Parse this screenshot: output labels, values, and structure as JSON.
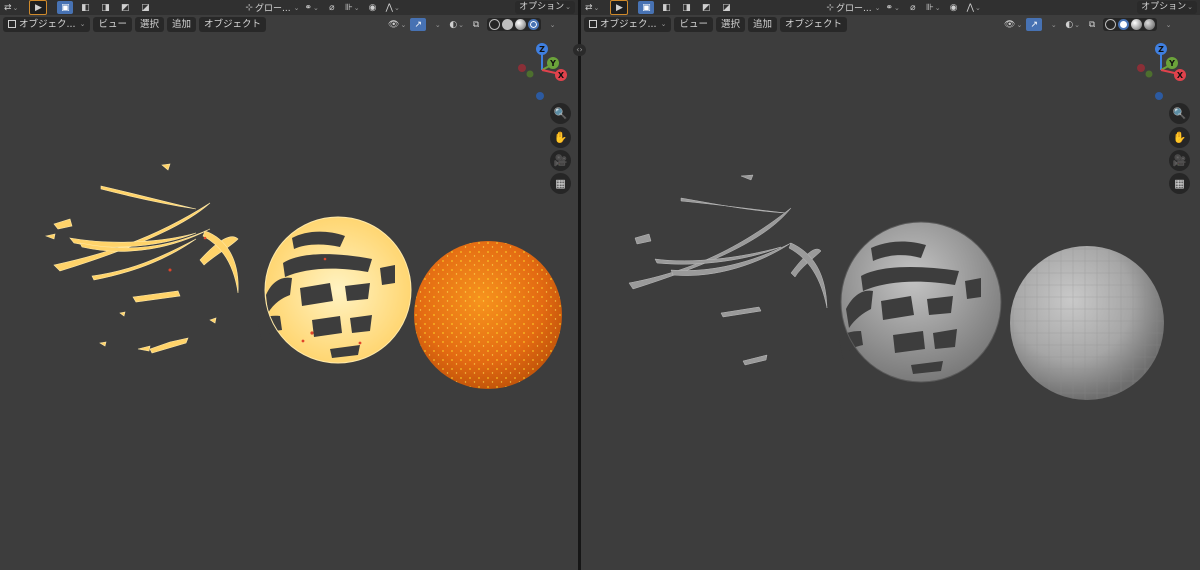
{
  "header": {
    "options_label": "オプション",
    "orientation_label": "グロー...",
    "menus": {
      "mode": "オブジェク...",
      "view": "ビュー",
      "select": "選択",
      "add": "追加",
      "object": "オブジェクト"
    }
  },
  "gizmo": {
    "z": "Z",
    "y": "Y",
    "x": "X"
  },
  "icons": {
    "tool_header": [
      "transform-icon",
      "select-cursor-icon",
      "select-box-mode-icons",
      "orientation-icon",
      "snap-icon",
      "proportional-edit-icon",
      "falloff-icon"
    ],
    "nav": [
      "zoom-icon",
      "pan-hand-icon",
      "camera-icon",
      "grid-icon"
    ],
    "shading": [
      "wireframe-shading",
      "solid-shading",
      "material-preview-shading",
      "rendered-shading"
    ]
  },
  "viewports": {
    "left": {
      "active_shading": "rendered",
      "objects": [
        "torn-fragments",
        "cage-sphere",
        "sphere"
      ]
    },
    "right": {
      "active_shading": "solid",
      "objects": [
        "torn-fragments",
        "cage-sphere",
        "sphere"
      ]
    }
  },
  "colors": {
    "viewport_bg": "#3d3d3d",
    "header_bg": "#303030",
    "active_blue": "#4772b3",
    "fire_orange": "#e8711a",
    "fire_yellow": "#ffd77a",
    "solid_gray": "#a8a8a8",
    "axis_x": "#e0424c",
    "axis_y": "#6ba33a",
    "axis_z": "#3f7fe0"
  }
}
